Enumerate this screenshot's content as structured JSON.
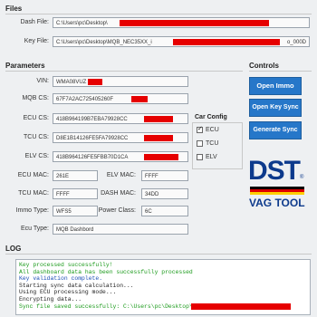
{
  "files": {
    "title": "Files",
    "dash_label": "Dash File:",
    "dash_value": "C:\\Users\\pc\\Desktop\\",
    "key_label": "Key File:",
    "key_value": "C:\\Users\\pc\\Desktop\\MQB_NEC35XX_i",
    "key_suffix": "o_000D"
  },
  "params": {
    "title": "Parameters",
    "vin_label": "VIN:",
    "vin_value": "WMA08VUZ",
    "mqbcs_label": "MQB CS:",
    "mqbcs_value": "67F7A2AC725405260F",
    "ecucs_label": "ECU CS:",
    "ecucs_value": "418B964199B7EBA79928CC",
    "tcucs_label": "TCU CS:",
    "tcucs_value": "D8E1B14126FE5FA79928CC",
    "elvcs_label": "ELV CS:",
    "elvcs_value": "418B964126FE5FBB70D1CA",
    "ecumac_label": "ECU MAC:",
    "ecumac_value": "261E",
    "elvmac_label": "ELV MAC:",
    "elvmac_value": "FFFF",
    "tcumac_label": "TCU MAC:",
    "tcumac_value": "FFFF",
    "dashmac_label": "DASH MAC:",
    "dashmac_value": "34DD",
    "immo_label": "Immo Type:",
    "immo_value": "WFS5",
    "power_label": "Power Class:",
    "power_value": "6C",
    "ecutype_label": "Ecu Type:",
    "ecutype_value": "MQB Dashbord"
  },
  "carconfig": {
    "title": "Car Config",
    "items": [
      {
        "label": "ECU",
        "checked": true
      },
      {
        "label": "TCU",
        "checked": false
      },
      {
        "label": "ELV",
        "checked": false
      }
    ]
  },
  "controls": {
    "title": "Controls",
    "open_immo": "Open Immo",
    "open_key_sync": "Open Key Sync",
    "generate_sync": "Generate Sync"
  },
  "logo": {
    "brand": "DST",
    "sub": "VAG TOOL",
    "flag_colors": [
      "#000000",
      "#dd0000",
      "#ffce00"
    ]
  },
  "log": {
    "title": "LOG",
    "lines": [
      {
        "text": "Key processed successfully!",
        "color": "#1a9a1a"
      },
      {
        "text": "All dashboard data has been successfully processed",
        "color": "#1a9a1a"
      },
      {
        "text": "Key validation complete.",
        "color": "#1c4fb5"
      },
      {
        "text": "Starting sync data calculation...",
        "color": "#222222"
      },
      {
        "text": "Using ECU processing mode...",
        "color": "#222222"
      },
      {
        "text": "Encrypting data...",
        "color": "#222222"
      },
      {
        "text": "Sync file saved successfully: C:\\Users\\pc\\Desktop\\MQB_NEC35XX",
        "color": "#1a9a1a"
      }
    ]
  }
}
